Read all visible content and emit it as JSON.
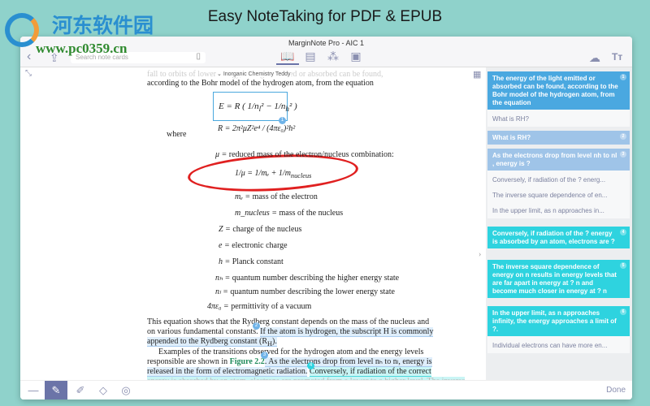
{
  "banner": "Easy NoteTaking for PDF & EPUB",
  "watermark": {
    "cn": "河东软件园",
    "url": "www.pc0359.cn"
  },
  "window": {
    "title": "MarginNote Pro - AIC 1"
  },
  "toolbar": {
    "search_placeholder": "Search note cards",
    "done": "Done"
  },
  "doc": {
    "breadcrumb": "Inorganic Chemistry Teddy",
    "faded_line": "fall to orbits of lower energy, the light emitted or absorbed can be found,",
    "line1": "according to the Bohr model of the hydrogen atom, from the equation",
    "where": "where",
    "defs": [
      {
        "sym": "μ =",
        "text": "reduced mass of the electron/nucleus combination:"
      },
      {
        "sym": "mₑ =",
        "text": "mass of the electron"
      },
      {
        "sym": "m_nucleus =",
        "text": "mass of the nucleus"
      },
      {
        "sym": "Z =",
        "text": "charge of the nucleus"
      },
      {
        "sym": "e =",
        "text": "electronic charge"
      },
      {
        "sym": "h =",
        "text": "Planck constant"
      },
      {
        "sym": "nₕ =",
        "text": "quantum number describing the higher energy state"
      },
      {
        "sym": "nₗ =",
        "text": "quantum number describing the lower energy state"
      },
      {
        "sym": "4πε₀ =",
        "text": "permittivity of a vacuum"
      }
    ],
    "para1a": "This equation shows that the Rydberg constant depends on the mass of the nucleus and",
    "para1b": "on various fundamental constants.",
    "para1c": "If the atom is hydrogen, the subscript H is commonly",
    "para1d": "appended to the Rydberg constant (R",
    "para1e": "H",
    "para1f": ").",
    "para2a": "Examples of the transitions observed for the hydrogen atom and the energy levels",
    "para2b": "responsible are shown in",
    "para2fig": "Figure 2.2",
    "para2c": ". As the electrons drop from level nₕ to nₗ, energy is",
    "para2d": "released in the form of electromagnetic radiation.",
    "para2e": "Conversely, if radiation of the correct",
    "para2f": "energy is absorbed by an atom, electrons are promoted from a lower to a higher level. The inverse"
  },
  "cards": [
    {
      "n": "1",
      "text": "The energy of the light emitted or absorbed can be found, according to the Bohr model of the hydrogen atom, from the equation",
      "color": "#4aa8e0",
      "subs": [
        "What is RH?"
      ]
    },
    {
      "n": "2",
      "text": "What is RH?",
      "color": "#9fc4e8",
      "subs": []
    },
    {
      "n": "3",
      "text": "As the electrons drop from level    nh to nl    , energy is ?",
      "color": "#9fc4e8",
      "subs": [
        "Conversely, if radiation of the ? energ...",
        "The inverse square dependence of en...",
        "In the upper limit, as  n  approaches in..."
      ]
    },
    {
      "n": "4",
      "text": "Conversely, if radiation of the ? energy is absorbed by an atom, electrons are ?",
      "color": "#2ed3df",
      "subs": []
    },
    {
      "n": "5",
      "text": "The inverse square dependence of energy on  n  results in energy levels that are far apart in energy at ?  n and become much closer in energy at ?  n",
      "color": "#2ed3df",
      "subs": []
    },
    {
      "n": "6",
      "text": "In the upper limit, as  n  approaches infinity, the energy approaches a limit of ?.",
      "color": "#2ed3df",
      "subs": [
        "Individual electrons can have more en..."
      ]
    }
  ],
  "icons": [
    "back-icon",
    "share-icon",
    "book-icon",
    "outline-icon",
    "mindmap-icon",
    "cards-icon",
    "cloud-sync-icon",
    "text-size-icon",
    "pen-icon",
    "highlighter-icon",
    "eraser-icon",
    "lasso-icon"
  ]
}
